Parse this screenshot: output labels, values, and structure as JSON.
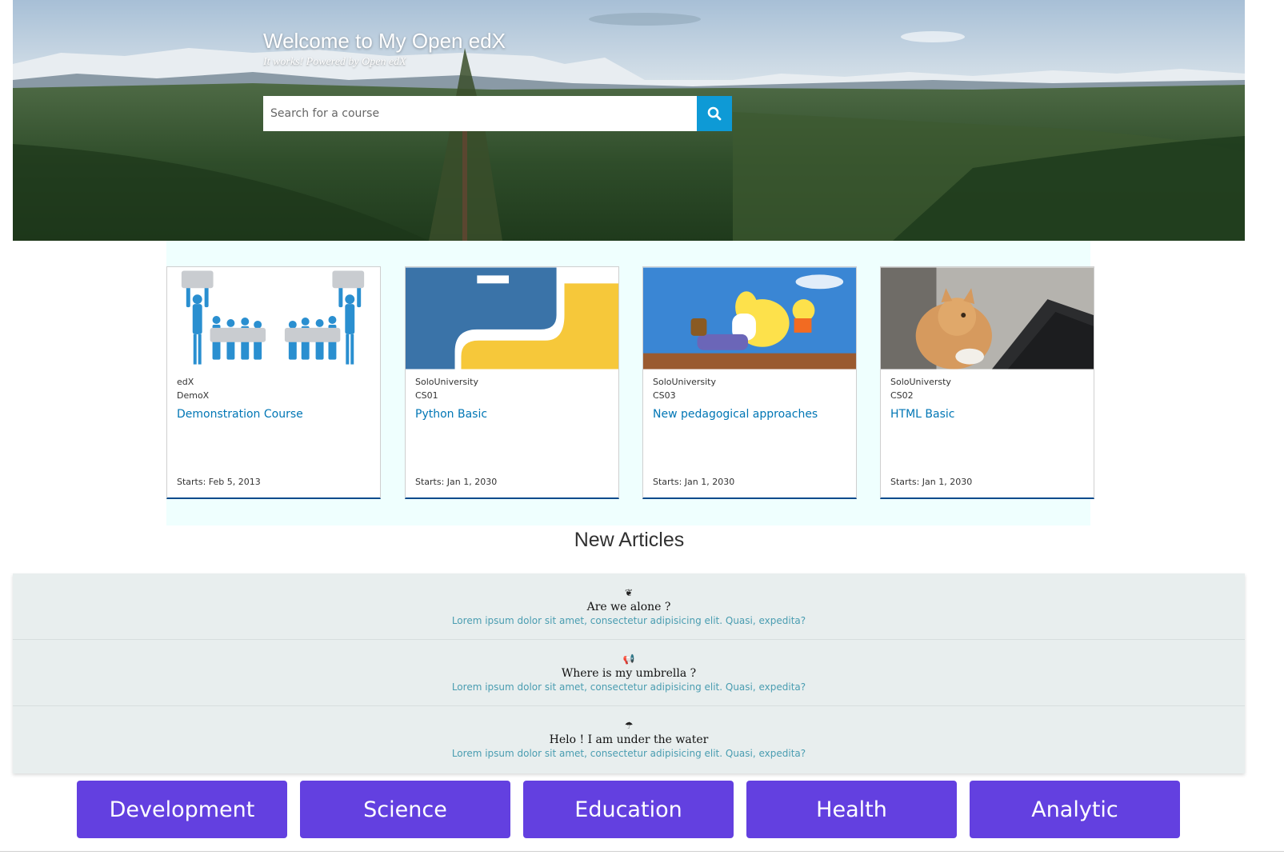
{
  "hero": {
    "title": "Welcome to My Open edX",
    "subtitle": "It works! Powered by Open edX",
    "search_placeholder": "Search for a course",
    "search_icon": "search-icon",
    "accent": "#0e9ad6"
  },
  "courses": [
    {
      "org": "edX",
      "code": "DemoX",
      "title": "Demonstration Course",
      "start": "Starts: Feb 5, 2013",
      "image": "puzzle-people"
    },
    {
      "org": "SoloUniversity",
      "code": "CS01",
      "title": "Python Basic",
      "start": "Starts: Jan 1, 2030",
      "image": "python-logo"
    },
    {
      "org": "SoloUniversity",
      "code": "CS03",
      "title": "New pedagogical approaches",
      "start": "Starts: Jan 1, 2030",
      "image": "cartoon"
    },
    {
      "org": "SoloUniversty",
      "code": "CS02",
      "title": "HTML Basic",
      "start": "Starts: Jan 1, 2030",
      "image": "cat-photo"
    }
  ],
  "articles": {
    "heading": "New Articles",
    "items": [
      {
        "icon": "leaf-icon",
        "glyph": "❦",
        "title": "Are we alone ?",
        "text": "Lorem ipsum dolor sit amet, consectetur adipisicing elit. Quasi, expedita?"
      },
      {
        "icon": "megaphone-icon",
        "glyph": "📢",
        "title": "Where is my umbrella ?",
        "text": "Lorem ipsum dolor sit amet, consectetur adipisicing elit. Quasi, expedita?"
      },
      {
        "icon": "umbrella-icon",
        "glyph": "☂",
        "title": "Helo ! I am under the water",
        "text": "Lorem ipsum dolor sit amet, consectetur adipisicing elit. Quasi, expedita?"
      }
    ]
  },
  "categories": [
    "Development",
    "Science",
    "Education",
    "Health",
    "Analytic"
  ],
  "colors": {
    "category_bg": "#6340e0",
    "link": "#0076b5",
    "article_text": "#4a9db1",
    "courses_band": "#effffe"
  }
}
